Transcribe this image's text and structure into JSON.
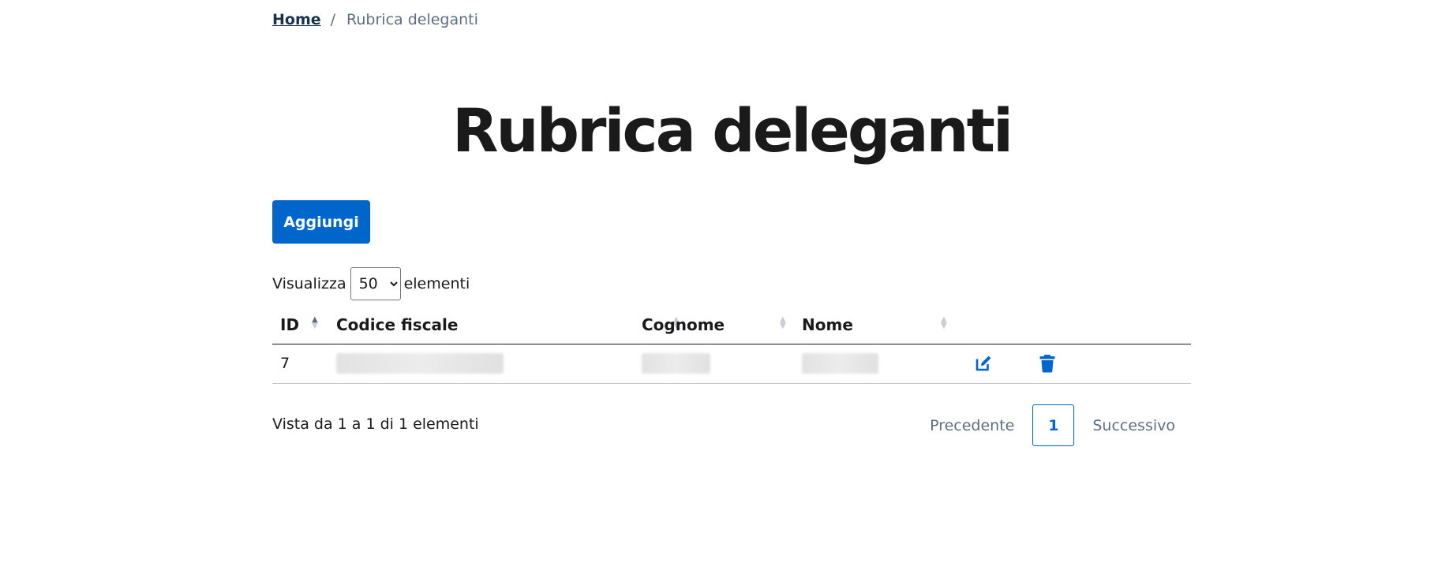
{
  "breadcrumb": {
    "home": "Home",
    "separator": "/",
    "current": "Rubrica deleganti"
  },
  "page": {
    "title": "Rubrica deleganti"
  },
  "actions": {
    "add_label": "Aggiungi"
  },
  "length_control": {
    "prefix": "Visualizza",
    "selected": "50",
    "suffix": "elementi"
  },
  "table": {
    "columns": [
      "ID",
      "Codice fiscale",
      "Cognome",
      "Nome"
    ],
    "sorted_column": "ID",
    "sort_direction": "ascending",
    "rows": [
      {
        "id": "7",
        "codice_fiscale": "",
        "cognome": "",
        "nome": "",
        "actions": [
          "edit-icon",
          "trash-icon"
        ]
      }
    ]
  },
  "footer": {
    "info": "Vista da 1 a 1 di 1 elementi",
    "pagination": {
      "previous": "Precedente",
      "current_page": "1",
      "next": "Successivo"
    }
  },
  "colors": {
    "primary": "#0066cc",
    "text": "#1a1a1a",
    "muted": "#5c6f82"
  }
}
